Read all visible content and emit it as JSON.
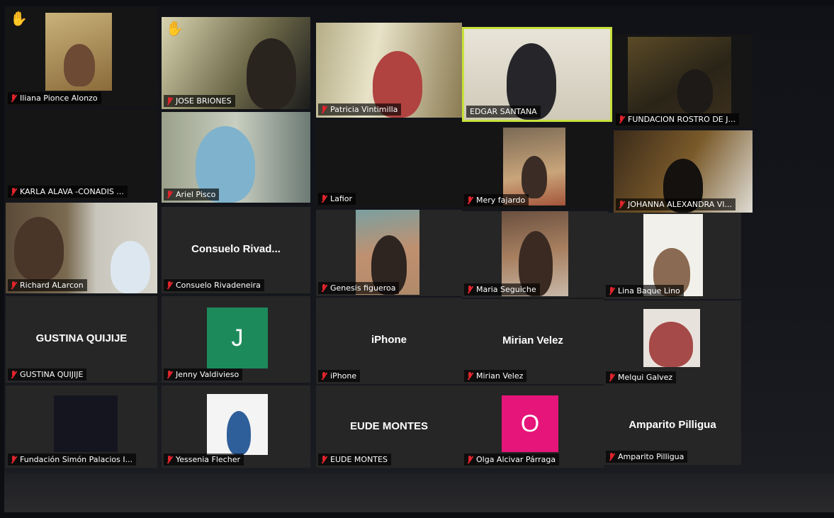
{
  "colors": {
    "active_border": "#c7e13a",
    "jenny_avatar": "#1d8a5c",
    "olga_avatar": "#e5157a",
    "muted_icon": "#e0242c",
    "raised_hand": "#f0a020"
  },
  "participants": {
    "iliana": "Iliana Pionce Alonzo",
    "jose": "JOSE BRIONES",
    "patricia": "Patricia Vintimilla",
    "edgar": "EDGAR SANTANA",
    "fundacion_rostro": "FUNDACION ROSTRO DE J...",
    "karla": "KARLA ALAVA -CONADIS ...",
    "ariel": "Ariel Pisco",
    "lafior": "Lafior",
    "mery": "Mery fajardo",
    "johanna": "JOHANNA ALEXANDRA VI...",
    "richard": "Richard ALarcon",
    "consuelo": "Consuelo Rivadeneira",
    "consuelo_center": "Consuelo Rivad...",
    "genesis": "Genesis figueroa",
    "maria": "Maria Seguiche",
    "lina": "Lina Baque Lino",
    "gustina": "GUSTINA QUIJIJE",
    "gustina_center": "GUSTINA QUIJIJE",
    "jenny": "Jenny Valdivieso",
    "jenny_initial": "J",
    "iphone": "iPhone",
    "iphone_center": "iPhone",
    "mirian": "Mirian Velez",
    "mirian_center": "Mirian Velez",
    "melqui": "Melqui Galvez",
    "fundacion_simon": "Fundación Simón Palacios I...",
    "yessenia": "Yessenia Flecher",
    "eude": "EUDE MONTES",
    "eude_center": "EUDE MONTES",
    "olga": "Olga Alcivar Párraga",
    "olga_initial": "O",
    "amparito": "Amparito Pilligua",
    "amparito_center": "Amparito Pilligua"
  },
  "icons": {
    "muted": "muted-mic-icon",
    "hand": "raised-hand-icon"
  }
}
